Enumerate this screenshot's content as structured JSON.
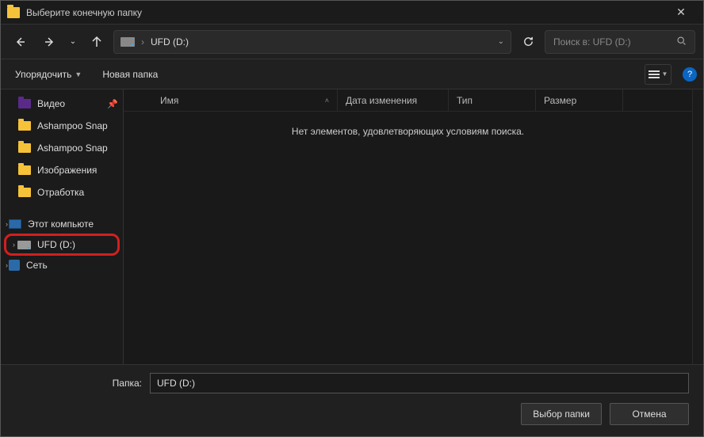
{
  "title": "Выберите конечную папку",
  "breadcrumb": {
    "location": "UFD (D:)"
  },
  "search": {
    "placeholder": "Поиск в: UFD (D:)"
  },
  "toolbar": {
    "organize": "Упорядочить",
    "new_folder": "Новая папка"
  },
  "columns": {
    "name": "Имя",
    "date": "Дата изменения",
    "type": "Тип",
    "size": "Размер"
  },
  "empty_msg": "Нет элементов, удовлетворяющих условиям поиска.",
  "sidebar": {
    "videos": "Видео",
    "snap1": "Ashampoo Snap",
    "snap2": "Ashampoo Snap",
    "images": "Изображения",
    "work": "Отработка",
    "thispc": "Этот компьюте",
    "ufd": "UFD (D:)",
    "network": "Сеть"
  },
  "footer": {
    "label": "Папка:",
    "value": "UFD (D:)",
    "select": "Выбор папки",
    "cancel": "Отмена"
  }
}
